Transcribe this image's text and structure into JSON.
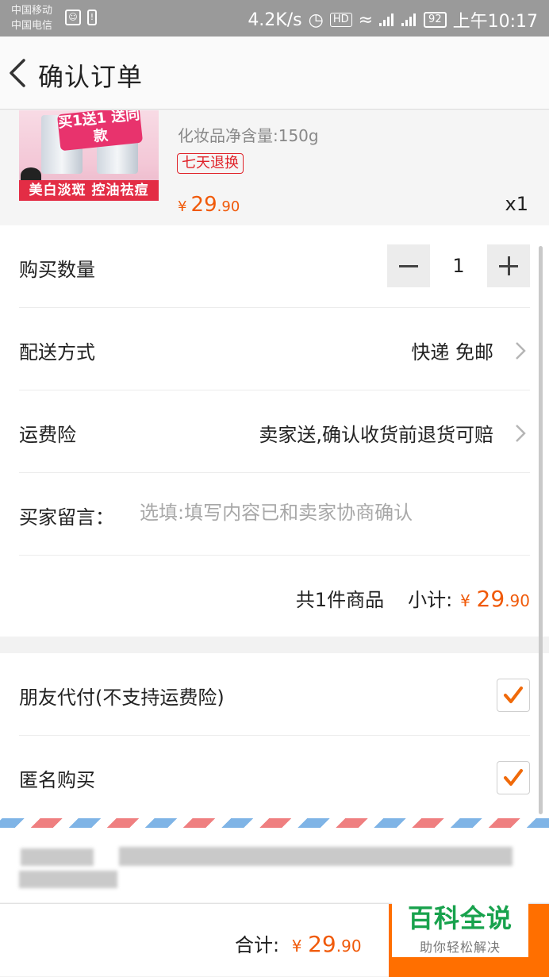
{
  "status_bar": {
    "carrier_1": "中国移动",
    "carrier_2": "中国电信",
    "net_speed": "4.2K/s",
    "hd": "HD",
    "net_1": "4G",
    "net_2": "2G",
    "battery": "92",
    "time": "上午10:17"
  },
  "header": {
    "title": "确认订单",
    "back_icon": "chevron-left-icon"
  },
  "product": {
    "promo_text": "买1送1 送同款",
    "banner_text": "美白淡斑 控油祛痘",
    "spec": "化妆品净含量:150g",
    "tag": "七天退换",
    "price_currency": "¥",
    "price_int": "29",
    "price_dec": ".90",
    "quantity": "x1"
  },
  "order": {
    "qty_label": "购买数量",
    "qty_value": "1",
    "delivery_label": "配送方式",
    "delivery_value": "快递 免邮",
    "insurance_label": "运费险",
    "insurance_value": "卖家送,确认收货前退货可赔",
    "message_label": "买家留言：",
    "message_placeholder": "选填:填写内容已和卖家协商确认",
    "count_text": "共1件商品",
    "subtotal_label": "小计:",
    "subtotal_currency": "¥",
    "subtotal_int": "29",
    "subtotal_dec": ".90"
  },
  "options": {
    "friend_pay_label": "朋友代付(不支持运费险)",
    "friend_pay_checked": true,
    "anonymous_label": "匿名购买",
    "anonymous_checked": true
  },
  "footer": {
    "total_label": "合计:",
    "total_currency": "¥",
    "total_int": "29",
    "total_dec": ".90"
  },
  "watermark": {
    "title": "百科全说",
    "subtitle": "助你轻松解决"
  },
  "colors": {
    "accent": "#f05a0a",
    "submit": "#ff6f00",
    "tag_red": "#e0232a",
    "check": "#f06a0a"
  }
}
